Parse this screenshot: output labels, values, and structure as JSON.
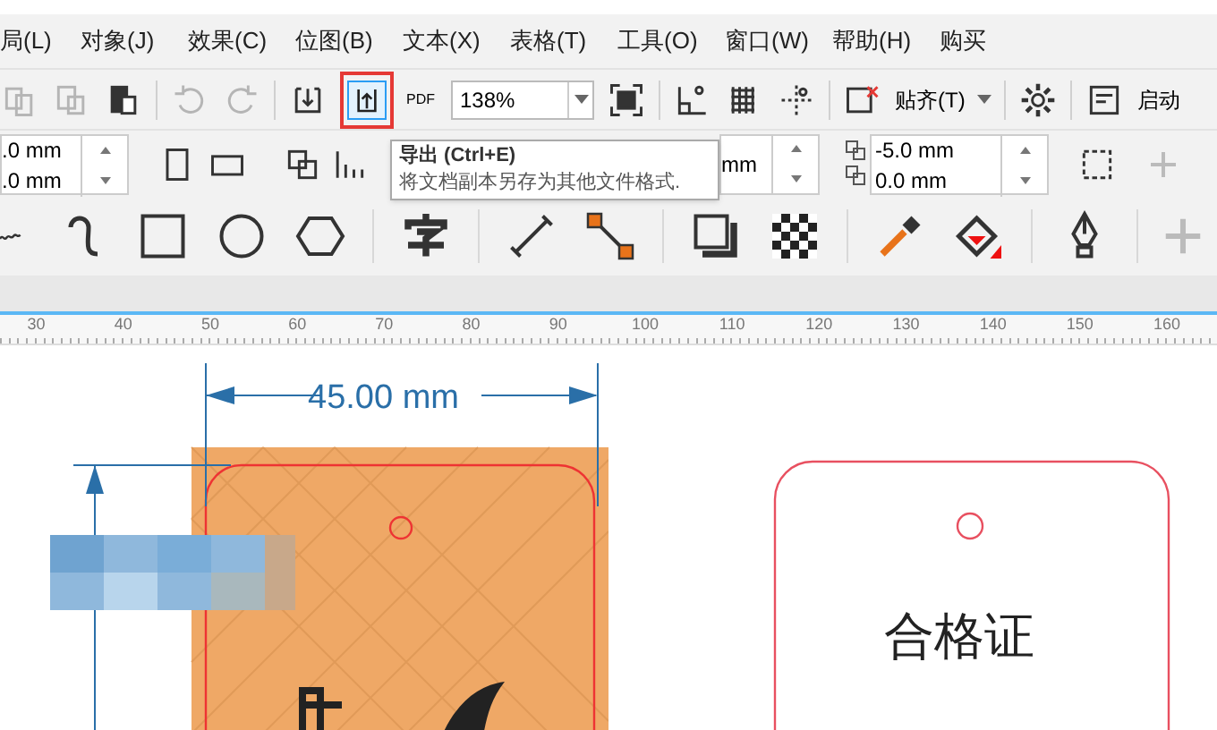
{
  "menu": [
    {
      "label": "局(L)"
    },
    {
      "label": "对象(J)"
    },
    {
      "label": "效果(C)"
    },
    {
      "label": "位图(B)"
    },
    {
      "label": "文本(X)"
    },
    {
      "label": "表格(T)"
    },
    {
      "label": "工具(O)"
    },
    {
      "label": "窗口(W)"
    },
    {
      "label": "帮助(H)"
    },
    {
      "label": "购买"
    }
  ],
  "toolbar": {
    "undo": {
      "disabled": true
    },
    "redo": {
      "disabled": true
    },
    "export": {
      "highlighted": true
    },
    "pdf_label": "PDF",
    "zoom": "138%",
    "snap": "贴齐(T)",
    "launch": "启动"
  },
  "property_bar": {
    "size_fields": [
      ".0 mm",
      ".0 mm"
    ],
    "mm_field": "mm",
    "offset_fields": [
      "-5.0 mm",
      "0.0 mm"
    ]
  },
  "tooltip": {
    "title": "导出 (Ctrl+E)",
    "description": "将文档副本另存为其他文件格式."
  },
  "ruler": {
    "labels": [
      "30",
      "40",
      "50",
      "60",
      "70",
      "80",
      "90",
      "100",
      "110",
      "120",
      "130",
      "140",
      "150",
      "160"
    ]
  },
  "canvas": {
    "dimension": "45.00 mm",
    "card_title": "合格证"
  }
}
